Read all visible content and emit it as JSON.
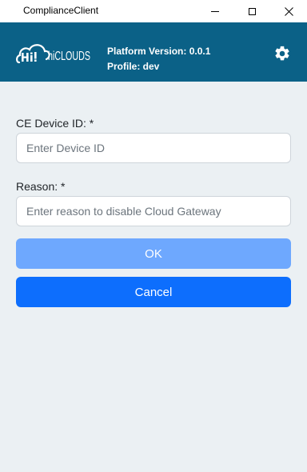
{
  "window": {
    "title": "ComplianceClient",
    "controls": [
      "minimize",
      "maximize",
      "close"
    ]
  },
  "header": {
    "logo_text": "hiCLOUDS",
    "platform_version": "Platform Version: 0.0.1",
    "profile": "Profile: dev",
    "settings_icon": "gear-icon",
    "background_color": "#0b6187"
  },
  "form": {
    "device_id": {
      "label": "CE Device ID: *",
      "placeholder": "Enter Device ID",
      "value": ""
    },
    "reason": {
      "label": "Reason: *",
      "placeholder": "Enter reason to disable Cloud Gateway",
      "value": ""
    }
  },
  "buttons": {
    "ok_label": "OK",
    "cancel_label": "Cancel",
    "ok_color": "#6ea8fe",
    "cancel_color": "#0d6efd"
  }
}
